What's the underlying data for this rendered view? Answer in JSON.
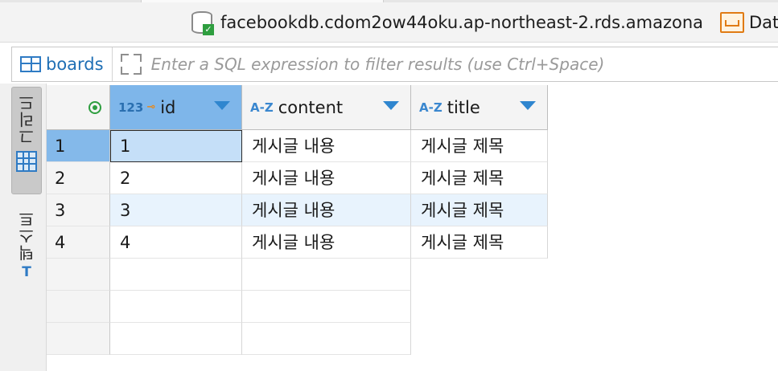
{
  "connection": {
    "host": "facebookdb.cdom2ow44oku.ap-northeast-2.rds.amazona",
    "datasource_label": "Dat",
    "icons": [
      "database-connected-icon",
      "folder-icon"
    ]
  },
  "filter": {
    "table_name": "boards",
    "placeholder": "Enter a SQL expression to filter results (use Ctrl+Space)",
    "value": ""
  },
  "side_tabs": {
    "grid_label": "그리드",
    "text_label": "텍스트",
    "text_icon": "T"
  },
  "grid": {
    "columns": [
      {
        "type": "123",
        "name": "id",
        "primary_key": true,
        "selected": true
      },
      {
        "type": "A-Z",
        "name": "content",
        "primary_key": false,
        "selected": false
      },
      {
        "type": "A-Z",
        "name": "title",
        "primary_key": false,
        "selected": false
      }
    ],
    "rows": [
      {
        "n": "1",
        "id": "1",
        "content": "게시글 내용",
        "title": "게시글 제목"
      },
      {
        "n": "2",
        "id": "2",
        "content": "게시글 내용",
        "title": "게시글 제목"
      },
      {
        "n": "3",
        "id": "3",
        "content": "게시글 내용",
        "title": "게시글 제목"
      },
      {
        "n": "4",
        "id": "4",
        "content": "게시글 내용",
        "title": "게시글 제목"
      }
    ],
    "colors": {
      "selected_header": "#7eb6ea",
      "alt_row": "#e8f3fd",
      "focus_cell": "#c5dff8"
    }
  }
}
